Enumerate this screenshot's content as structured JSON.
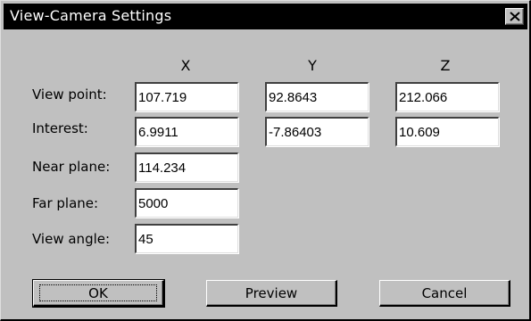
{
  "window": {
    "title": "View-Camera Settings",
    "close_icon": "close-icon"
  },
  "columns": [
    "X",
    "Y",
    "Z"
  ],
  "rows": {
    "view_point": {
      "label": "View point:",
      "x": "107.719",
      "y": "92.8643",
      "z": "212.066"
    },
    "interest": {
      "label": "Interest:",
      "x": "6.9911",
      "y": "-7.86403",
      "z": "10.609"
    },
    "near_plane": {
      "label": "Near plane:",
      "value": "114.234"
    },
    "far_plane": {
      "label": "Far plane:",
      "value": "5000"
    },
    "view_angle": {
      "label": "View angle:",
      "value": "45"
    }
  },
  "buttons": {
    "ok": "OK",
    "preview": "Preview",
    "cancel": "Cancel"
  }
}
